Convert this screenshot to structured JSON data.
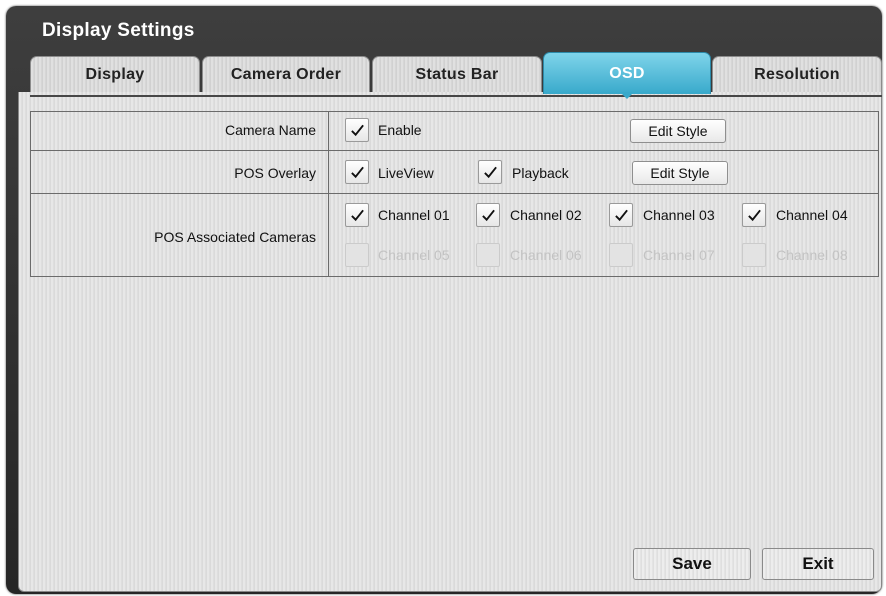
{
  "window": {
    "title": "Display Settings"
  },
  "tabs": [
    {
      "label": "Display",
      "active": false
    },
    {
      "label": "Camera Order",
      "active": false
    },
    {
      "label": "Status Bar",
      "active": false
    },
    {
      "label": "OSD",
      "active": true
    },
    {
      "label": "Resolution",
      "active": false
    }
  ],
  "rows": {
    "camera_name": {
      "label": "Camera Name",
      "enable": {
        "label": "Enable",
        "checked": true
      },
      "edit_style_label": "Edit Style"
    },
    "pos_overlay": {
      "label": "POS Overlay",
      "liveview": {
        "label": "LiveView",
        "checked": true
      },
      "playback": {
        "label": "Playback",
        "checked": true
      },
      "edit_style_label": "Edit Style"
    },
    "pos_cameras": {
      "label": "POS Associated Cameras",
      "channels": [
        {
          "label": "Channel 01",
          "checked": true,
          "enabled": true
        },
        {
          "label": "Channel 02",
          "checked": true,
          "enabled": true
        },
        {
          "label": "Channel 03",
          "checked": true,
          "enabled": true
        },
        {
          "label": "Channel 04",
          "checked": true,
          "enabled": true
        },
        {
          "label": "Channel 05",
          "checked": false,
          "enabled": false
        },
        {
          "label": "Channel 06",
          "checked": false,
          "enabled": false
        },
        {
          "label": "Channel 07",
          "checked": false,
          "enabled": false
        },
        {
          "label": "Channel 08",
          "checked": false,
          "enabled": false
        }
      ]
    }
  },
  "footer": {
    "save_label": "Save",
    "exit_label": "Exit"
  },
  "colors": {
    "active_tab": "#38a9cb",
    "title_bar": "#2e2e2e",
    "panel": "#e0e0e0"
  },
  "icons": {
    "checkbox_check": "checkmark-icon"
  }
}
